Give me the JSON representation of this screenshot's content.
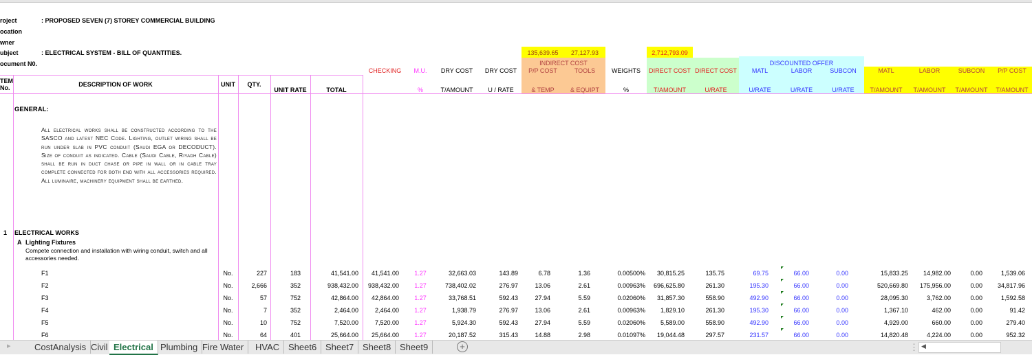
{
  "info": {
    "project_label": "roject",
    "project_value": ": PROPOSED SEVEN (7) STOREY COMMERCIAL BUILDING",
    "location_label": "ocation",
    "owner_label": "wner",
    "subject_label": "ubject",
    "subject_value": ": ELECTRICAL SYSTEM - BILL OF QUANTITIES.",
    "document_label": "ocument N0."
  },
  "totals": {
    "pp_cost": "135,639.65",
    "tools": "27,127.93",
    "direct_cost": "2,712,793.09"
  },
  "headers": {
    "item": "TEM",
    "item2": "No.",
    "description": "DESCRIPTION OF WORK",
    "unit": "UNIT",
    "qty": "QTY.",
    "unit_rate": "UNIT RATE",
    "total": "TOTAL",
    "checking": "CHECKING",
    "mu": "M.U.",
    "mu2": "%",
    "dry1": "DRY COST",
    "dry1b": "T/AMOUNT",
    "dry2": "DRY COST",
    "dry2b": "U / RATE",
    "indirect": "INDIRECT COST",
    "pp": "P/P COST",
    "pp2": "& TEMP",
    "tools": "TOOLS",
    "tools2": "& EQUIPT",
    "weights": "WEIGHTS",
    "weights2": "%",
    "direct1": "DIRECT COST",
    "direct1b": "T/AMOUNT",
    "direct2": "DIRECT COST",
    "direct2b": "U/RATE",
    "discounted": "DISCOUNTED OFFER",
    "d_matl": "MATL",
    "d_labor": "LABOR",
    "d_subcon": "SUBCON",
    "urate": "U/RATE",
    "t_matl": "MATL",
    "t_labor": "LABOR",
    "t_subcon": "SUBCON",
    "t_pp": "P/P COST",
    "tamount": "T/AMOUNT"
  },
  "body": {
    "general": "GENERAL:",
    "paragraph": "All electrical works shall be constructed according to the SASCO and latest NEC Code. Lighting, outlet wiring shall be run under slab in PVC conduit (Saudi EGA or DECODUCT). Size of conduit as indicated. Cable (Saudi Cable, Riyadh Cable) shall be run in duct chase or pipe in wall or in cable tray complete connected for both end with all accessories required. All luminaire, machinery equipment shall be earthed.",
    "item_no": "1",
    "section": "ELECTRICAL WORKS",
    "sub_letter": "A",
    "sub_title": "Lighting Fixtures",
    "sub_desc1": "Compete connection and installation with wiring conduit, switch and all",
    "sub_desc2": "accessories needed."
  },
  "rows": [
    [
      "F1",
      "No.",
      "227",
      "183",
      "41,541.00",
      "41,541.00",
      "1.27",
      "32,663.03",
      "143.89",
      "6.78",
      "1.36",
      "0.00500%",
      "30,815.25",
      "135.75",
      "69.75",
      "66.00",
      "0.00",
      "15,833.25",
      "14,982.00",
      "0.00",
      "1,539.06"
    ],
    [
      "F2",
      "No.",
      "2,666",
      "352",
      "938,432.00",
      "938,432.00",
      "1.27",
      "738,402.02",
      "276.97",
      "13.06",
      "2.61",
      "0.00963%",
      "696,625.80",
      "261.30",
      "195.30",
      "66.00",
      "0.00",
      "520,669.80",
      "175,956.00",
      "0.00",
      "34,817.96"
    ],
    [
      "F3",
      "No.",
      "57",
      "752",
      "42,864.00",
      "42,864.00",
      "1.27",
      "33,768.51",
      "592.43",
      "27.94",
      "5.59",
      "0.02060%",
      "31,857.30",
      "558.90",
      "492.90",
      "66.00",
      "0.00",
      "28,095.30",
      "3,762.00",
      "0.00",
      "1,592.58"
    ],
    [
      "F4",
      "No.",
      "7",
      "352",
      "2,464.00",
      "2,464.00",
      "1.27",
      "1,938.79",
      "276.97",
      "13.06",
      "2.61",
      "0.00963%",
      "1,829.10",
      "261.30",
      "195.30",
      "66.00",
      "0.00",
      "1,367.10",
      "462.00",
      "0.00",
      "91.42"
    ],
    [
      "F5",
      "No.",
      "10",
      "752",
      "7,520.00",
      "7,520.00",
      "1.27",
      "5,924.30",
      "592.43",
      "27.94",
      "5.59",
      "0.02060%",
      "5,589.00",
      "558.90",
      "492.90",
      "66.00",
      "0.00",
      "4,929.00",
      "660.00",
      "0.00",
      "279.40"
    ],
    [
      "F6",
      "No.",
      "64",
      "401",
      "25,664.00",
      "25,664.00",
      "1.27",
      "20,187.52",
      "315.43",
      "14.88",
      "2.98",
      "0.01097%",
      "19,044.48",
      "297.57",
      "231.57",
      "66.00",
      "0.00",
      "14,820.48",
      "4,224.00",
      "0.00",
      "952.32"
    ]
  ],
  "sheets": [
    "CostAnalysis",
    "Civil",
    "Electrical",
    "Plumbing",
    "Fire Water",
    "HVAC",
    "Sheet6",
    "Sheet7",
    "Sheet8",
    "Sheet9"
  ],
  "active_sheet": "Electrical"
}
